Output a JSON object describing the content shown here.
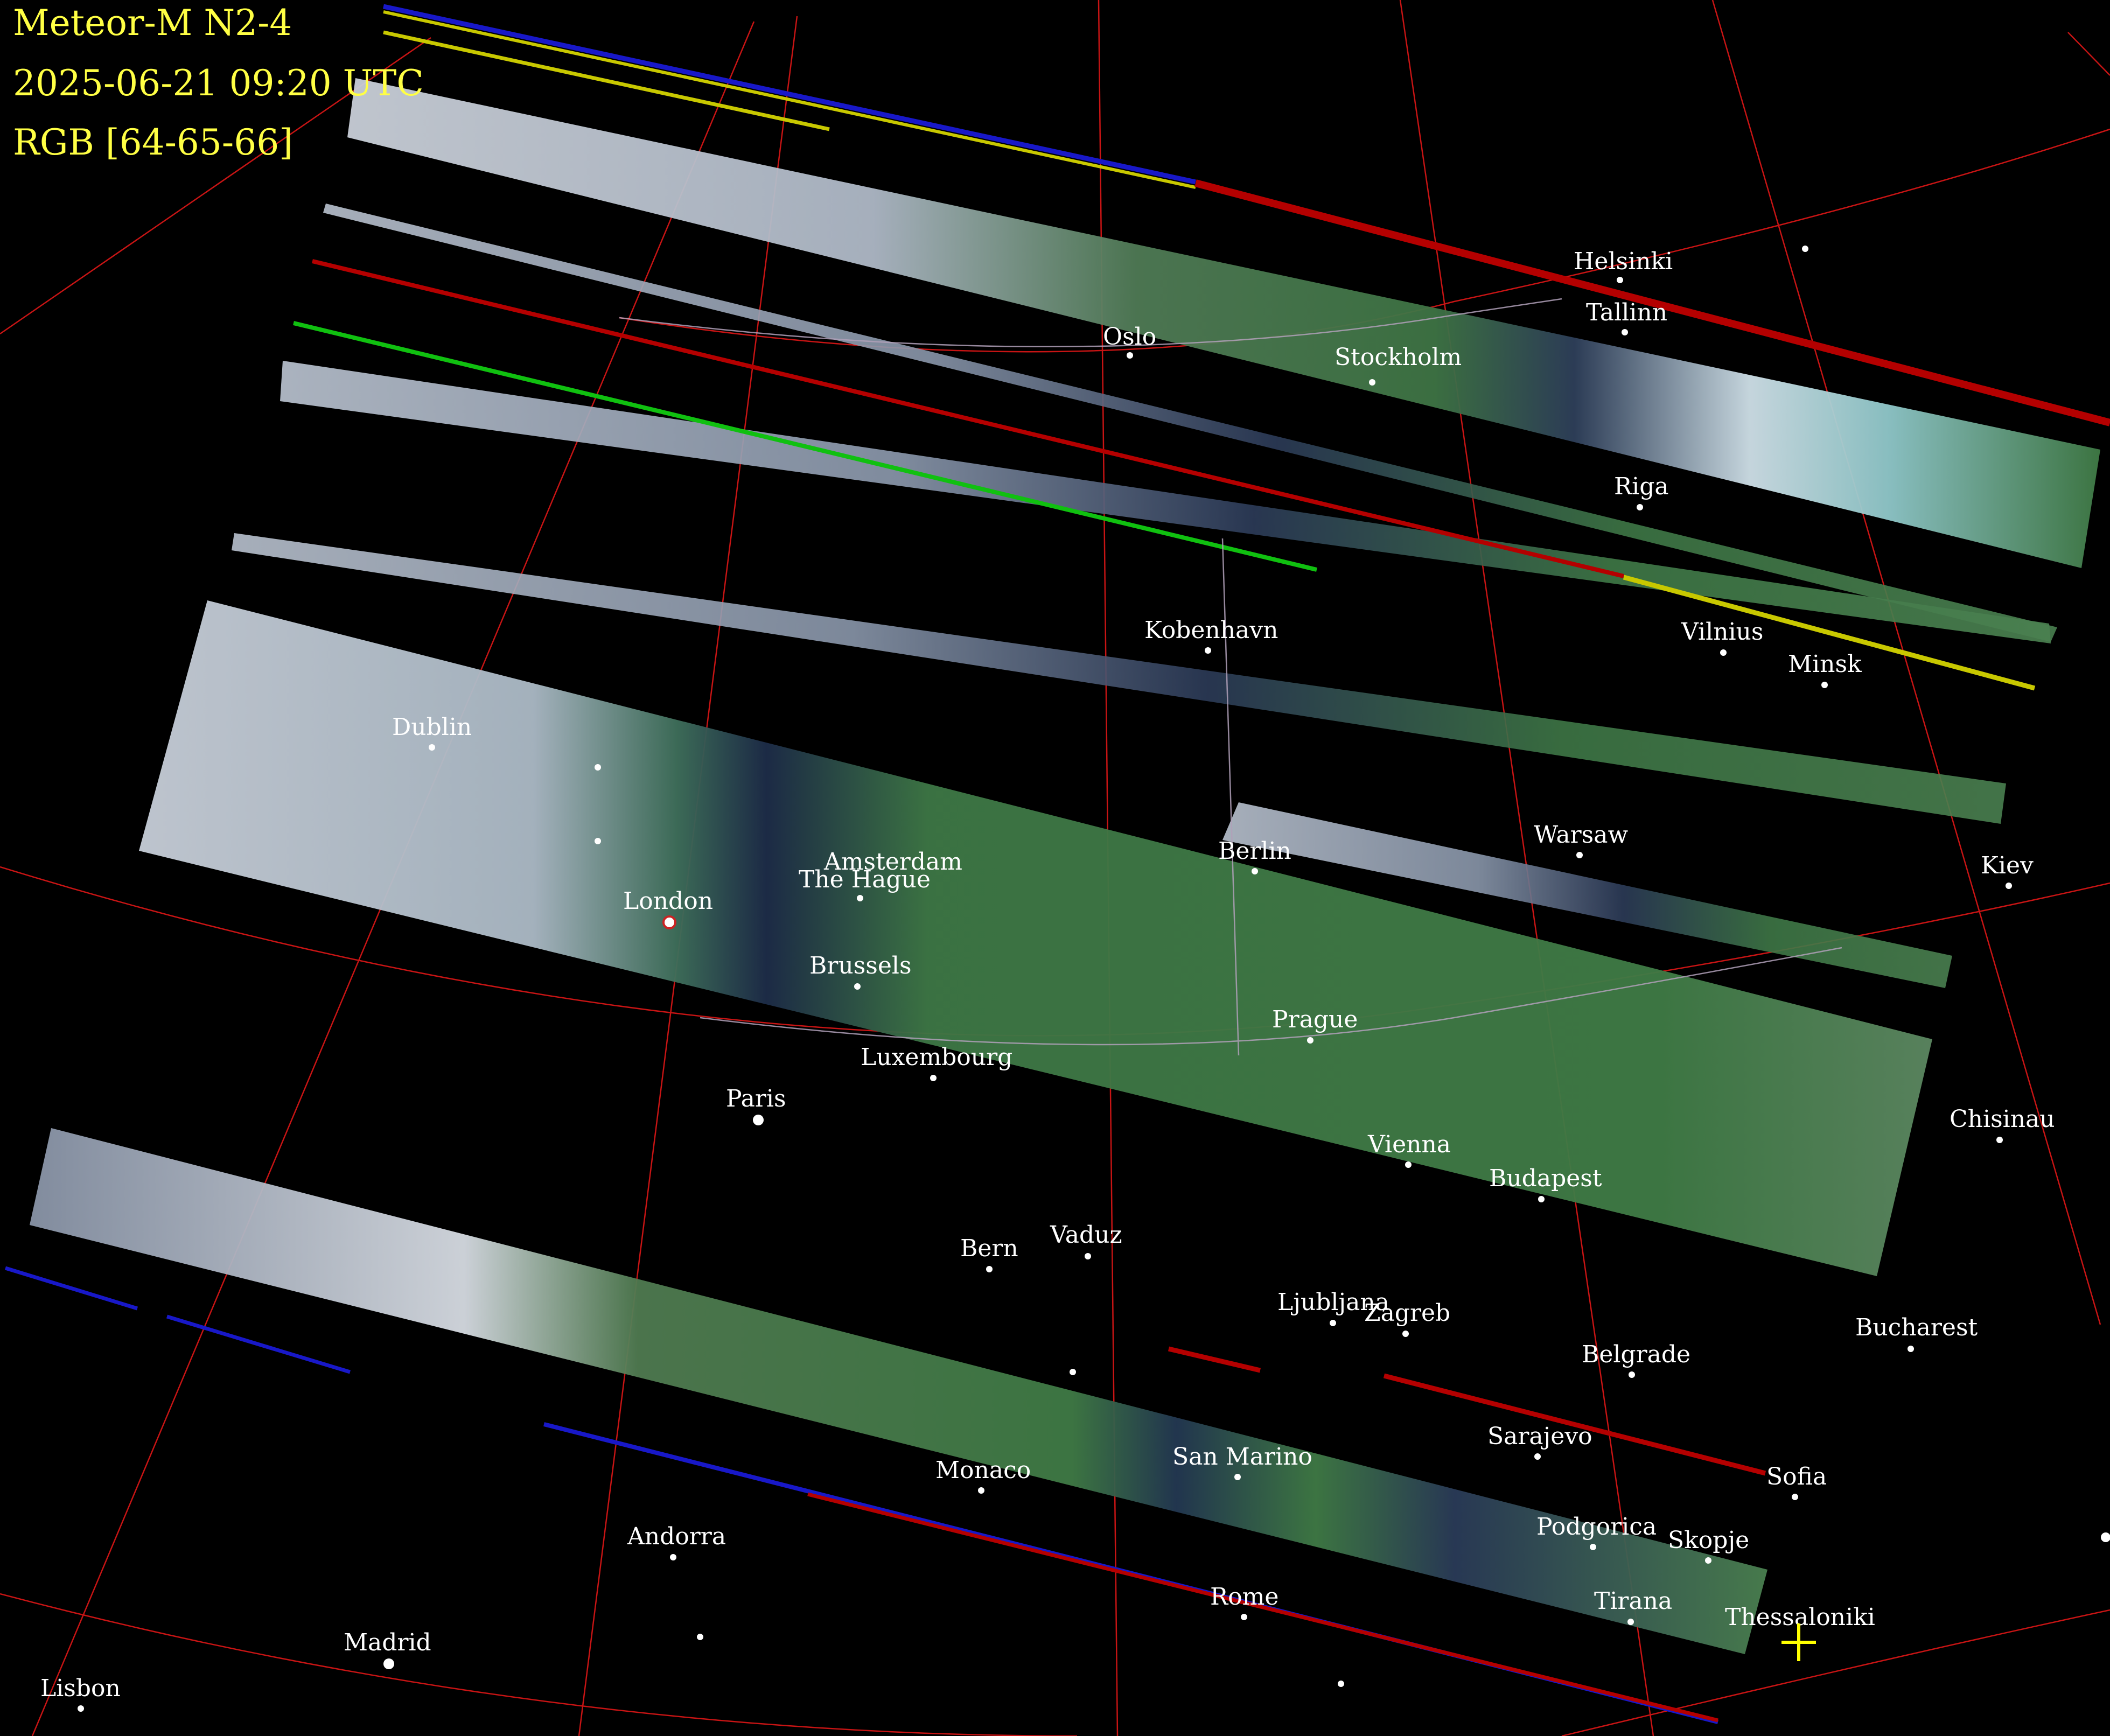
{
  "header": {
    "satellite": "Meteor-M N2-4",
    "datetime": "2025-06-21 09:20 UTC",
    "composite": "RGB [64-65-66]",
    "text_color": "#ffff44"
  },
  "colors": {
    "background": "#000000",
    "graticule": "#c81414",
    "border_line": "#b0a0b8",
    "city_label": "#ffffff",
    "land": "#3f7a45",
    "cloud": "#c9cfd8",
    "sea": "#1e2f50",
    "artifact_yellow": "#c8c800",
    "artifact_red": "#b40000",
    "artifact_green": "#10c010",
    "artifact_blue": "#1818c8",
    "crosshair": "#ffff00"
  },
  "cities": [
    {
      "name": "Helsinki"
    },
    {
      "name": "Tallinn"
    },
    {
      "name": "Oslo"
    },
    {
      "name": "Stockholm"
    },
    {
      "name": "Riga"
    },
    {
      "name": "Kobenhavn"
    },
    {
      "name": "Vilnius"
    },
    {
      "name": "Minsk"
    },
    {
      "name": "Dublin"
    },
    {
      "name": "Warsaw"
    },
    {
      "name": "Kiev"
    },
    {
      "name": "Amsterdam"
    },
    {
      "name": "The Hague"
    },
    {
      "name": "Berlin"
    },
    {
      "name": "London"
    },
    {
      "name": "Brussels"
    },
    {
      "name": "Prague"
    },
    {
      "name": "Luxembourg"
    },
    {
      "name": "Paris"
    },
    {
      "name": "Chisinau"
    },
    {
      "name": "Vienna"
    },
    {
      "name": "Budapest"
    },
    {
      "name": "Vaduz"
    },
    {
      "name": "Bern"
    },
    {
      "name": "Ljubljana"
    },
    {
      "name": "Zagreb"
    },
    {
      "name": "Bucharest"
    },
    {
      "name": "Belgrade"
    },
    {
      "name": "Sarajevo"
    },
    {
      "name": "San Marino"
    },
    {
      "name": "Sofia"
    },
    {
      "name": "Monaco"
    },
    {
      "name": "Podgorica"
    },
    {
      "name": "Skopje"
    },
    {
      "name": "Andorra"
    },
    {
      "name": "Rome"
    },
    {
      "name": "Tirana"
    },
    {
      "name": "Thessaloniki"
    },
    {
      "name": "Madrid"
    },
    {
      "name": "Lisbon"
    }
  ]
}
